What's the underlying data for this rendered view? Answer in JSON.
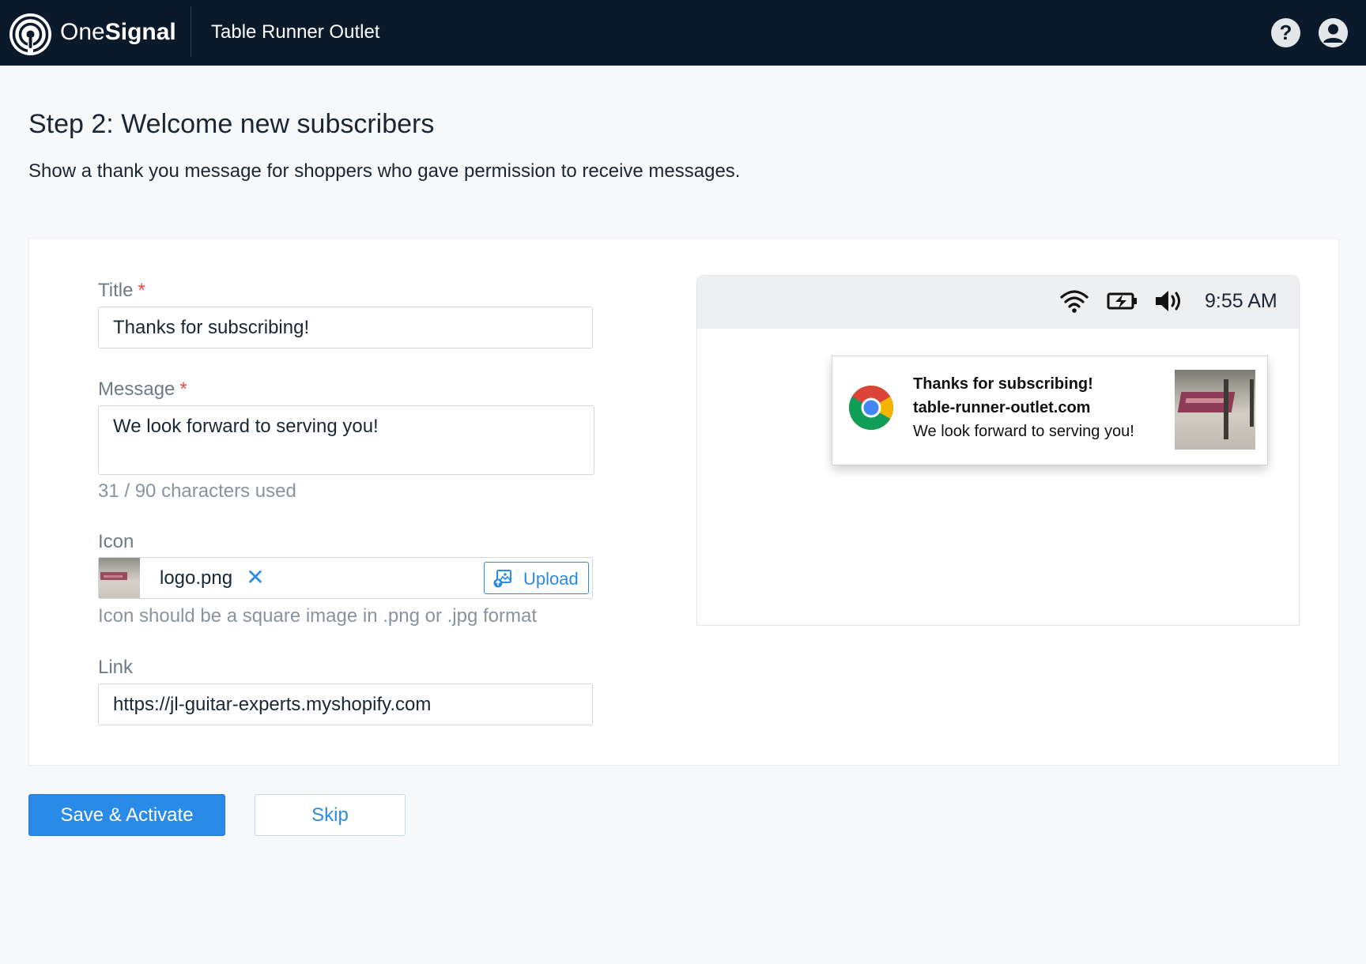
{
  "header": {
    "brand_light": "One",
    "brand_bold": "Signal",
    "app_name": "Table Runner Outlet",
    "help_glyph": "?",
    "icons": {
      "logo": "onesignal-logo-icon",
      "help": "help-circle-icon",
      "account": "user-account-icon"
    }
  },
  "page": {
    "title": "Step 2: Welcome new subscribers",
    "subtitle": "Show a thank you message for shoppers who gave permission to receive messages."
  },
  "form": {
    "required_marker": "*",
    "title": {
      "label": "Title",
      "value": "Thanks for subscribing!"
    },
    "message": {
      "label": "Message",
      "value": "We look forward to serving you!",
      "counter": "31 / 90 characters used"
    },
    "icon": {
      "label": "Icon",
      "file_name": "logo.png",
      "remove_glyph": "✕",
      "upload_label": "Upload",
      "help": "Icon should be a square image in .png or .jpg format"
    },
    "link": {
      "label": "Link",
      "value": "https://jl-guitar-experts.myshopify.com"
    }
  },
  "preview": {
    "clock": "9:55 AM",
    "status_icons": [
      "wifi-icon",
      "battery-charging-icon",
      "volume-icon"
    ],
    "notification": {
      "title": "Thanks for subscribing!",
      "site": "table-runner-outlet.com",
      "message": "We look forward to serving you!",
      "browser_icon": "chrome-icon"
    }
  },
  "actions": {
    "primary": "Save & Activate",
    "secondary": "Skip"
  },
  "colors": {
    "nav_bg": "#0a1a2b",
    "accent": "#2a8ae8",
    "required": "#e5484d",
    "page_bg": "#f7f8fa"
  }
}
